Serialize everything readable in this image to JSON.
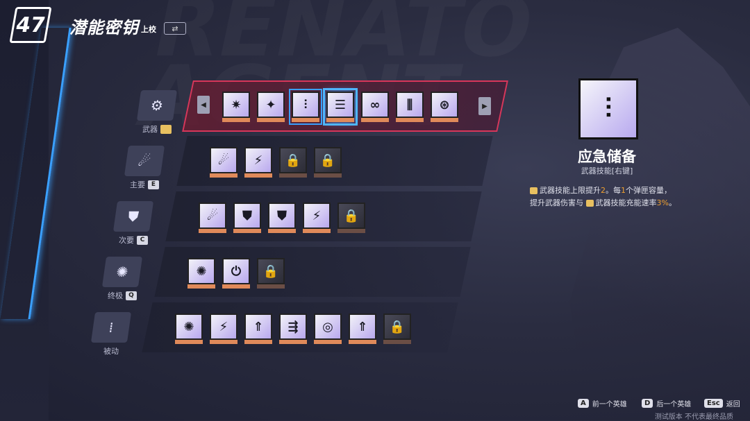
{
  "header": {
    "logo_text": "47",
    "title": "潜能密钥",
    "rank": "上校",
    "swap_icon": "swap-icon",
    "swap_symbol": "⇄"
  },
  "categories": [
    {
      "label": "武器",
      "key": "",
      "icon": "gear-icon",
      "symbol": "⚙"
    },
    {
      "label": "主要",
      "key": "E",
      "icon": "comet-icon",
      "symbol": "☄"
    },
    {
      "label": "次要",
      "key": "C",
      "icon": "shield-icon",
      "symbol": "⛊"
    },
    {
      "label": "终极",
      "key": "Q",
      "icon": "spider-icon",
      "symbol": "✺"
    },
    {
      "label": "被动",
      "key": "",
      "icon": "bullets-icon",
      "symbol": "⁞"
    }
  ],
  "rows": {
    "weapon": [
      {
        "symbol": "✷",
        "locked": false
      },
      {
        "symbol": "✦",
        "locked": false
      },
      {
        "symbol": "⫶",
        "locked": false,
        "state": "selected"
      },
      {
        "symbol": "☰",
        "locked": false,
        "state": "highlighted"
      },
      {
        "symbol": "∞",
        "locked": false
      },
      {
        "symbol": "⫼",
        "locked": false
      },
      {
        "symbol": "⊛",
        "locked": false
      }
    ],
    "primary": [
      {
        "symbol": "☄",
        "locked": false
      },
      {
        "symbol": "⚡",
        "locked": false
      },
      {
        "symbol": "🔒",
        "locked": true
      },
      {
        "symbol": "🔒",
        "locked": true
      }
    ],
    "secondary": [
      {
        "symbol": "☄",
        "locked": false
      },
      {
        "symbol": "⛊",
        "locked": false
      },
      {
        "symbol": "⛊",
        "locked": false
      },
      {
        "symbol": "⚡",
        "locked": false
      },
      {
        "symbol": "🔒",
        "locked": true
      }
    ],
    "ultimate": [
      {
        "symbol": "✺",
        "locked": false
      },
      {
        "symbol": "⏻",
        "locked": false
      },
      {
        "symbol": "🔒",
        "locked": true
      }
    ],
    "passive": [
      {
        "symbol": "✺",
        "locked": false
      },
      {
        "symbol": "⚡",
        "locked": false
      },
      {
        "symbol": "⇑",
        "locked": false
      },
      {
        "symbol": "⇶",
        "locked": false
      },
      {
        "symbol": "◎",
        "locked": false
      },
      {
        "symbol": "⇑",
        "locked": false
      },
      {
        "symbol": "🔒",
        "locked": true
      }
    ]
  },
  "arrows": {
    "left": "◀",
    "right": "▶"
  },
  "detail": {
    "icon": "battery-bolt-icon",
    "icon_symbol": "⫶",
    "title": "应急储备",
    "subtitle": "武器技能[右键]",
    "line1_a": "武器技能上限提升",
    "line1_v1": "2",
    "line1_b": "。每",
    "line1_v2": "1",
    "line1_c": "个弹匣容量，",
    "line2_a": "提升武器伤害与",
    "line2_b": "武器技能充能速率",
    "line2_v": "3%",
    "line2_c": "。"
  },
  "footer": {
    "prev_key": "A",
    "prev_label": "前一个英雄",
    "next_key": "D",
    "next_label": "后一个英雄",
    "back_key": "Esc",
    "back_label": "返回",
    "disclaimer": "测试版本 不代表最终品质"
  },
  "colors": {
    "accent_blue": "#3aa0ff",
    "active_row_border": "#d8365a",
    "highlight_text": "#f0a030"
  }
}
